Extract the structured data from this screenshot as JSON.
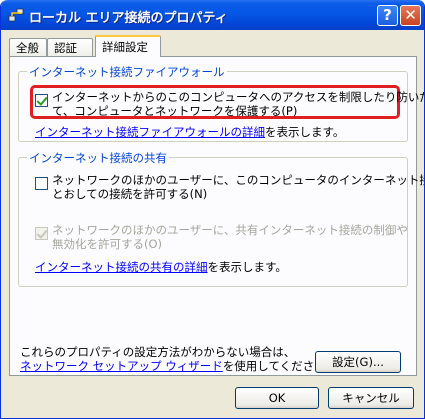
{
  "window": {
    "title": "ローカル エリア接続のプロパティ",
    "help_glyph": "?",
    "close_glyph": "✕"
  },
  "tabs": [
    {
      "label": "全般"
    },
    {
      "label": "認証"
    },
    {
      "label": "詳細設定",
      "selected": true
    }
  ],
  "firewall_group": {
    "title": "インターネット接続ファイアウォール",
    "checkbox_line1": "インターネットからのこのコンピュータへのアクセスを制限したり防いだりし",
    "checkbox_line2": "て、コンピュータとネットワークを保護する(P)",
    "checked": true,
    "link": "インターネット接続ファイアウォールの詳細",
    "link_suffix": "を表示します。"
  },
  "sharing_group": {
    "title": "インターネット接続の共有",
    "checkbox1_line1": "ネットワークのほかのユーザーに、このコンピュータのインターネット接続を",
    "checkbox1_line2": "とおしての接続を許可する(N)",
    "checkbox1_checked": false,
    "checkbox2_line1": "ネットワークのほかのユーザーに、共有インターネット接続の制御や",
    "checkbox2_line2": "無効化を許可する(O)",
    "checkbox2_checked": true,
    "checkbox2_disabled": true,
    "link": "インターネット接続の共有の詳細",
    "link_suffix": "を表示します。"
  },
  "footer_note": {
    "line1": "これらのプロパティの設定方法がわからない場合は、",
    "link": "ネットワーク セットアップ ウィザード",
    "line2_suffix": "を使用してください。"
  },
  "buttons": {
    "settings": "設定(G)...",
    "ok": "OK",
    "cancel": "キャンセル"
  },
  "colors": {
    "titlebar": "#0456e4",
    "highlight_border": "#e02020",
    "group_title": "#0046d5",
    "link": "#0000ff"
  }
}
